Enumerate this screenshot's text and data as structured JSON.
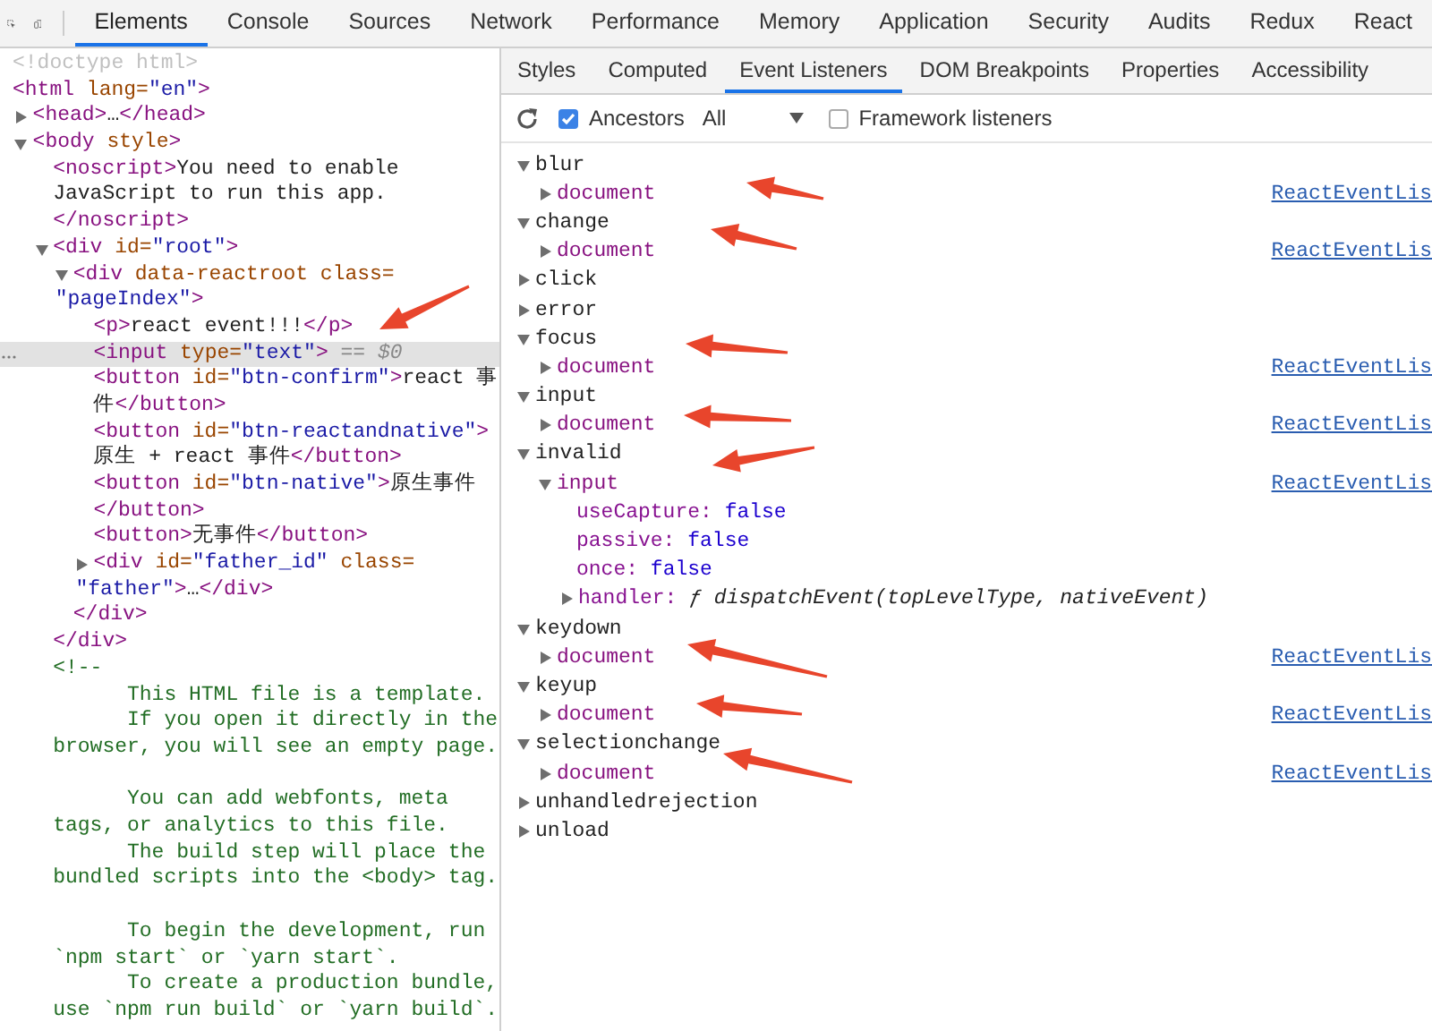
{
  "tabs": [
    {
      "label": "Elements",
      "selected": true
    },
    {
      "label": "Console",
      "selected": false
    },
    {
      "label": "Sources",
      "selected": false
    },
    {
      "label": "Network",
      "selected": false
    },
    {
      "label": "Performance",
      "selected": false
    },
    {
      "label": "Memory",
      "selected": false
    },
    {
      "label": "Application",
      "selected": false
    },
    {
      "label": "Security",
      "selected": false
    },
    {
      "label": "Audits",
      "selected": false
    },
    {
      "label": "Redux",
      "selected": false
    },
    {
      "label": "React",
      "selected": false
    }
  ],
  "dom": {
    "nodes": [
      {
        "kind": "element",
        "selected": false,
        "lines": [
          [
            {
              "kind": "doctype",
              "text": "<!doctype html>"
            }
          ]
        ]
      },
      {
        "kind": "element",
        "selected": false,
        "lines": [
          [
            {
              "kind": "tag",
              "text": "<html"
            },
            {
              "kind": "attr",
              "text": " lang="
            },
            {
              "kind": "value",
              "text": "\"en\""
            },
            {
              "kind": "tag",
              "text": ">"
            }
          ]
        ],
        "children": [
          {
            "kind": "element",
            "selected": false,
            "expanded": false,
            "lines": [
              [
                {
                  "kind": "tag",
                  "text": "<head>"
                },
                {
                  "kind": "text",
                  "text": "…"
                },
                {
                  "kind": "tag",
                  "text": "</head>"
                }
              ]
            ]
          },
          {
            "kind": "element",
            "selected": false,
            "expanded": true,
            "lines": [
              [
                {
                  "kind": "tag",
                  "text": "<body"
                },
                {
                  "kind": "attr",
                  "text": " style"
                },
                {
                  "kind": "tag",
                  "text": ">"
                }
              ]
            ],
            "children": [
              {
                "kind": "element",
                "selected": false,
                "lines": [
                  [
                    {
                      "kind": "tag",
                      "text": "<noscript>"
                    },
                    {
                      "kind": "text",
                      "text": "You need to enable"
                    }
                  ],
                  [
                    {
                      "kind": "text",
                      "text": "JavaScript to run this app."
                    }
                  ],
                  [
                    {
                      "kind": "tag",
                      "text": "</noscript>"
                    }
                  ]
                ]
              },
              {
                "kind": "element",
                "selected": false,
                "expanded": true,
                "lines": [
                  [
                    {
                      "kind": "tag",
                      "text": "<div"
                    },
                    {
                      "kind": "attr",
                      "text": " id="
                    },
                    {
                      "kind": "value",
                      "text": "\"root\""
                    },
                    {
                      "kind": "tag",
                      "text": ">"
                    }
                  ]
                ],
                "close": [
                  {
                    "kind": "tag",
                    "text": "</div>"
                  }
                ],
                "children": [
                  {
                    "kind": "element",
                    "selected": false,
                    "expanded": true,
                    "lines": [
                      [
                        {
                          "kind": "tag",
                          "text": "<div"
                        },
                        {
                          "kind": "attr",
                          "text": " data-reactroot class="
                        }
                      ],
                      [
                        {
                          "kind": "value",
                          "text": "\"pageIndex\""
                        },
                        {
                          "kind": "tag",
                          "text": ">"
                        }
                      ]
                    ],
                    "close": [
                      {
                        "kind": "tag",
                        "text": "</div>"
                      }
                    ],
                    "children": [
                      {
                        "kind": "element",
                        "selected": false,
                        "lines": [
                          [
                            {
                              "kind": "tag",
                              "text": "<p>"
                            },
                            {
                              "kind": "text",
                              "text": "react event!!!"
                            },
                            {
                              "kind": "tag",
                              "text": "</p>"
                            }
                          ]
                        ]
                      },
                      {
                        "kind": "element",
                        "selected": true,
                        "lines": [
                          [
                            {
                              "kind": "tag",
                              "text": "<input"
                            },
                            {
                              "kind": "attr",
                              "text": " type="
                            },
                            {
                              "kind": "value",
                              "text": "\"text\""
                            },
                            {
                              "kind": "tag",
                              "text": ">"
                            },
                            {
                              "kind": "hint",
                              "text": " == $0"
                            }
                          ]
                        ]
                      },
                      {
                        "kind": "element",
                        "selected": false,
                        "lines": [
                          [
                            {
                              "kind": "tag",
                              "text": "<button"
                            },
                            {
                              "kind": "attr",
                              "text": " id="
                            },
                            {
                              "kind": "value",
                              "text": "\"btn-confirm\""
                            },
                            {
                              "kind": "tag",
                              "text": ">"
                            },
                            {
                              "kind": "text",
                              "text": "react 事"
                            }
                          ],
                          [
                            {
                              "kind": "text",
                              "text": "件"
                            },
                            {
                              "kind": "tag",
                              "text": "</button>"
                            }
                          ]
                        ]
                      },
                      {
                        "kind": "element",
                        "selected": false,
                        "lines": [
                          [
                            {
                              "kind": "tag",
                              "text": "<button"
                            },
                            {
                              "kind": "attr",
                              "text": " id="
                            },
                            {
                              "kind": "value",
                              "text": "\"btn-reactandnative\""
                            },
                            {
                              "kind": "tag",
                              "text": ">"
                            }
                          ],
                          [
                            {
                              "kind": "text",
                              "text": "原生 + react 事件"
                            },
                            {
                              "kind": "tag",
                              "text": "</button>"
                            }
                          ]
                        ]
                      },
                      {
                        "kind": "element",
                        "selected": false,
                        "lines": [
                          [
                            {
                              "kind": "tag",
                              "text": "<button"
                            },
                            {
                              "kind": "attr",
                              "text": " id="
                            },
                            {
                              "kind": "value",
                              "text": "\"btn-native\""
                            },
                            {
                              "kind": "tag",
                              "text": ">"
                            },
                            {
                              "kind": "text",
                              "text": "原生事件"
                            }
                          ],
                          [
                            {
                              "kind": "tag",
                              "text": "</button>"
                            }
                          ]
                        ]
                      },
                      {
                        "kind": "element",
                        "selected": false,
                        "lines": [
                          [
                            {
                              "kind": "tag",
                              "text": "<button>"
                            },
                            {
                              "kind": "text",
                              "text": "无事件"
                            },
                            {
                              "kind": "tag",
                              "text": "</button>"
                            }
                          ]
                        ]
                      },
                      {
                        "kind": "element",
                        "selected": false,
                        "expanded": false,
                        "lines": [
                          [
                            {
                              "kind": "tag",
                              "text": "<div"
                            },
                            {
                              "kind": "attr",
                              "text": " id="
                            },
                            {
                              "kind": "value",
                              "text": "\"father_id\""
                            },
                            {
                              "kind": "attr",
                              "text": " class="
                            }
                          ],
                          [
                            {
                              "kind": "value",
                              "text": "\"father\""
                            },
                            {
                              "kind": "tag",
                              "text": ">"
                            },
                            {
                              "kind": "text",
                              "text": "…"
                            },
                            {
                              "kind": "tag",
                              "text": "</div>"
                            }
                          ]
                        ]
                      }
                    ]
                  }
                ]
              },
              {
                "kind": "comment",
                "selected": false,
                "text": "<!--\n      This HTML file is a template.\n      If you open it directly in the\nbrowser, you will see an empty page.\n\n      You can add webfonts, meta\ntags, or analytics to this file.\n      The build step will place the\nbundled scripts into the <body> tag.\n\n      To begin the development, run\n`npm start` or `yarn start`.\n      To create a production bundle,\nuse `npm run build` or `yarn build`."
              }
            ]
          }
        ]
      }
    ]
  },
  "sidebar": {
    "tabs": [
      {
        "label": "Styles",
        "selected": false
      },
      {
        "label": "Computed",
        "selected": false
      },
      {
        "label": "Event Listeners",
        "selected": true
      },
      {
        "label": "DOM Breakpoints",
        "selected": false
      },
      {
        "label": "Properties",
        "selected": false
      },
      {
        "label": "Accessibility",
        "selected": false
      }
    ],
    "toolbar": {
      "ancestors": {
        "label": "Ancestors",
        "checked": true
      },
      "filter": {
        "value": "All"
      },
      "framework": {
        "label": "Framework listeners",
        "checked": false
      }
    },
    "events": [
      {
        "name": "blur",
        "expanded": true,
        "listeners": [
          {
            "target": "document",
            "expanded": false,
            "link": "ReactEventLis"
          }
        ]
      },
      {
        "name": "change",
        "expanded": true,
        "listeners": [
          {
            "target": "document",
            "expanded": false,
            "link": "ReactEventLis"
          }
        ]
      },
      {
        "name": "click",
        "expanded": false
      },
      {
        "name": "error",
        "expanded": false
      },
      {
        "name": "focus",
        "expanded": true,
        "listeners": [
          {
            "target": "document",
            "expanded": false,
            "link": "ReactEventLis"
          }
        ]
      },
      {
        "name": "input",
        "expanded": true,
        "listeners": [
          {
            "target": "document",
            "expanded": false,
            "link": "ReactEventLis"
          }
        ]
      },
      {
        "name": "invalid",
        "expanded": true,
        "listeners": [
          {
            "target": "input",
            "expanded": true,
            "link": "ReactEventLis",
            "properties": [
              {
                "kind": "boolean",
                "key": "useCapture:",
                "value": "false"
              },
              {
                "kind": "boolean",
                "key": "passive:",
                "value": "false"
              },
              {
                "kind": "boolean",
                "key": "once:",
                "value": "false"
              },
              {
                "kind": "function",
                "key": "handler:",
                "value": "ƒ dispatchEvent(topLevelType, nativeEvent)",
                "expanded": false
              }
            ]
          }
        ]
      },
      {
        "name": "keydown",
        "expanded": true,
        "listeners": [
          {
            "target": "document",
            "expanded": false,
            "link": "ReactEventLis"
          }
        ]
      },
      {
        "name": "keyup",
        "expanded": true,
        "listeners": [
          {
            "target": "document",
            "expanded": false,
            "link": "ReactEventLis"
          }
        ]
      },
      {
        "name": "selectionchange",
        "expanded": true,
        "listeners": [
          {
            "target": "document",
            "expanded": false,
            "link": "ReactEventLis"
          }
        ]
      },
      {
        "name": "unhandledrejection",
        "expanded": false
      },
      {
        "name": "unload",
        "expanded": false
      }
    ]
  }
}
